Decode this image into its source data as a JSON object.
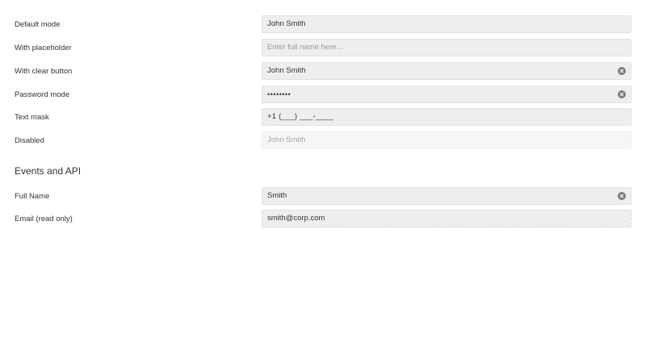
{
  "fields": {
    "default_mode": {
      "label": "Default mode",
      "value": "John Smith"
    },
    "with_placeholder": {
      "label": "With placeholder",
      "placeholder": "Enter full name here..."
    },
    "with_clear_button": {
      "label": "With clear button",
      "value": "John Smith"
    },
    "password_mode": {
      "label": "Password mode",
      "value": "••••••••"
    },
    "text_mask": {
      "label": "Text mask",
      "value": "+1 (___) ___-____"
    },
    "disabled": {
      "label": "Disabled",
      "value": "John Smith"
    }
  },
  "events_section": {
    "title": "Events and API",
    "full_name": {
      "label": "Full Name",
      "value": "Smith"
    },
    "email": {
      "label": "Email (read only)",
      "value": "smith@corp.com"
    }
  },
  "icons": {
    "clear": "clear-circle-x-icon"
  },
  "colors": {
    "field_bg": "#eeeeee",
    "disabled_bg": "#f6f6f6",
    "text": "#333333",
    "placeholder": "#9a9a9a",
    "clear_icon": "#7a7a7a"
  }
}
